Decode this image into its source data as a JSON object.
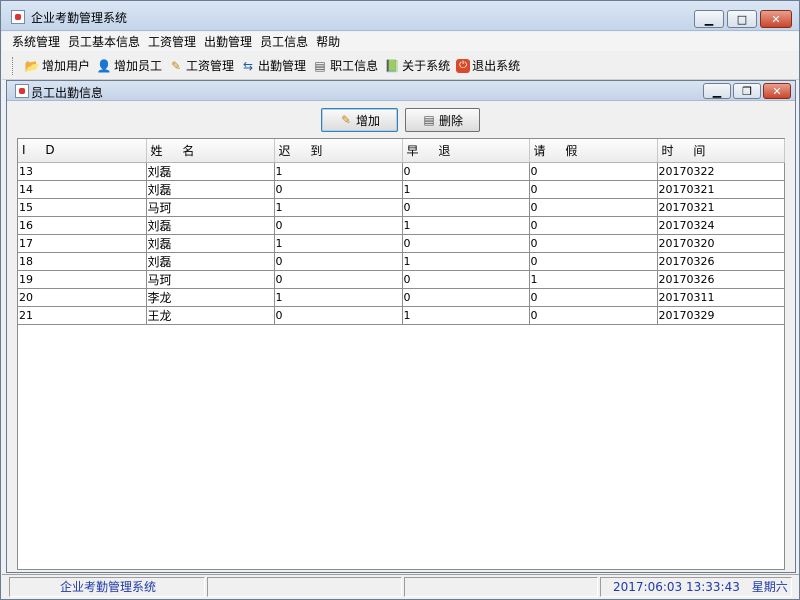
{
  "window": {
    "title": "企业考勤管理系统",
    "min_icon": "minimize-icon",
    "max_icon": "maximize-icon",
    "close_icon": "close-icon"
  },
  "menu": {
    "items": [
      "系统管理",
      "员工基本信息",
      "工资管理",
      "出勤管理",
      "员工信息",
      "帮助"
    ]
  },
  "toolbar": {
    "items": [
      {
        "label": "增加用户",
        "icon": "folder-open-icon"
      },
      {
        "label": "增加员工",
        "icon": "user-icon"
      },
      {
        "label": "工资管理",
        "icon": "edit-icon"
      },
      {
        "label": "出勤管理",
        "icon": "attendance-icon"
      },
      {
        "label": "职工信息",
        "icon": "document-icon"
      },
      {
        "label": "关于系统",
        "icon": "book-icon"
      },
      {
        "label": "退出系统",
        "icon": "exit-icon"
      }
    ]
  },
  "frame": {
    "title": "员工出勤信息",
    "add_button": "增加",
    "delete_button": "删除"
  },
  "table": {
    "columns": [
      "I D",
      "姓 名",
      "迟 到",
      "早 退",
      "请 假",
      "时 间"
    ],
    "rows": [
      [
        "13",
        "刘磊",
        "1",
        "0",
        "0",
        "20170322"
      ],
      [
        "14",
        "刘磊",
        "0",
        "1",
        "0",
        "20170321"
      ],
      [
        "15",
        "马珂",
        "1",
        "0",
        "0",
        "20170321"
      ],
      [
        "16",
        "刘磊",
        "0",
        "1",
        "0",
        "20170324"
      ],
      [
        "17",
        "刘磊",
        "1",
        "0",
        "0",
        "20170320"
      ],
      [
        "18",
        "刘磊",
        "0",
        "1",
        "0",
        "20170326"
      ],
      [
        "19",
        "马珂",
        "0",
        "0",
        "1",
        "20170326"
      ],
      [
        "20",
        "李龙",
        "1",
        "0",
        "0",
        "20170311"
      ],
      [
        "21",
        "王龙",
        "0",
        "1",
        "0",
        "20170329"
      ]
    ]
  },
  "status": {
    "app_name": "企业考勤管理系统",
    "datetime": "2017:06:03  13:33:43",
    "weekday": "星期六",
    "text_color": "#1e3aa8"
  }
}
